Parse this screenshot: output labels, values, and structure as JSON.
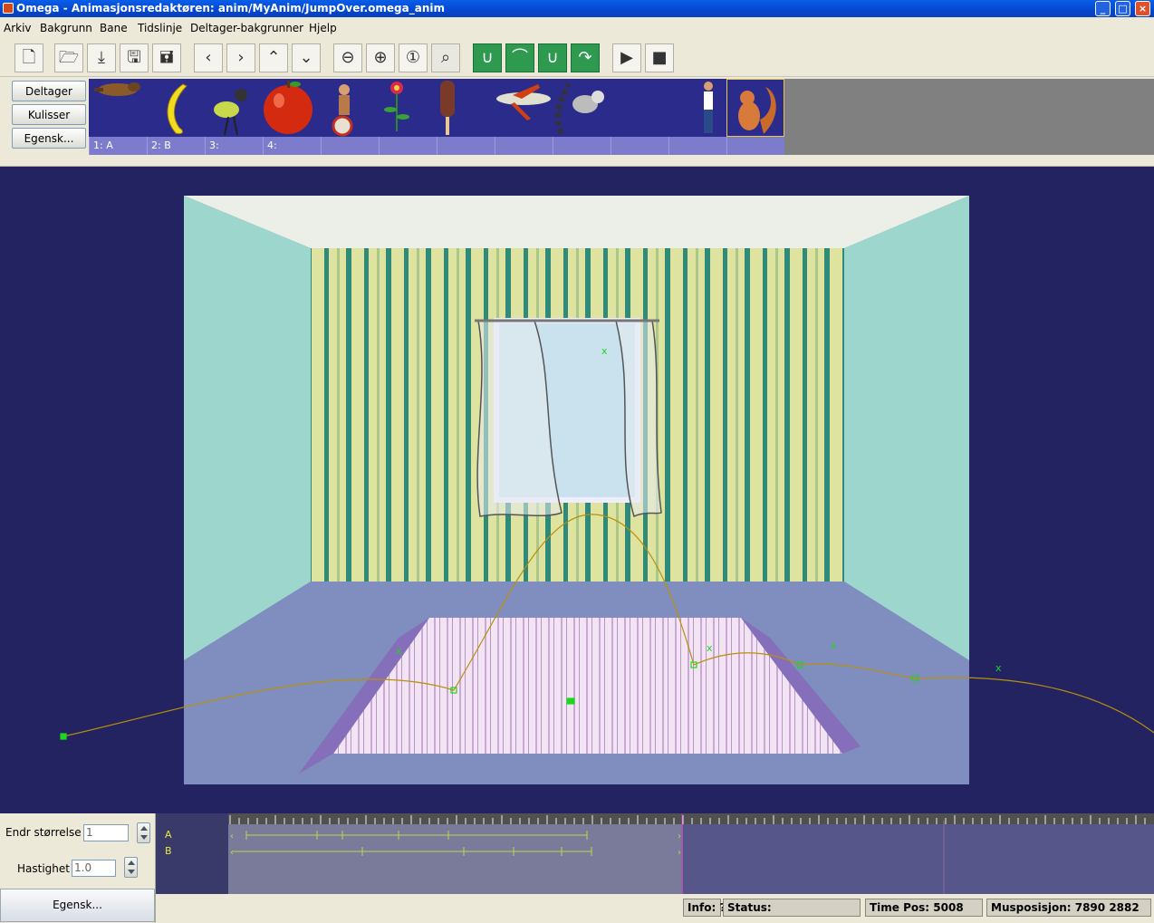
{
  "window": {
    "title": "Omega - Animasjonsredaktøren: anim/MyAnim/JumpOver.omega_anim",
    "min_label": "_",
    "max_label": "□",
    "close_label": "×"
  },
  "menu": [
    "Arkiv",
    "Bakgrunn",
    "Bane",
    "Tidslinje",
    "Deltager-bakgrunner",
    "Hjelp"
  ],
  "toolbar": {
    "icons": [
      "new-file-icon",
      "open-folder-icon",
      "open-web-icon",
      "save-icon",
      "save-as-icon",
      "arrow-left-icon",
      "arrow-right-icon",
      "arrow-up-icon",
      "arrow-down-icon",
      "zoom-out-icon",
      "zoom-in-icon",
      "zoom-actual-icon",
      "zoom-fit-icon",
      "path-add-icon",
      "path-curve-icon",
      "path-plus-one-icon",
      "path-half-icon",
      "play-icon",
      "stop-icon"
    ]
  },
  "side_buttons": {
    "deltager": "Deltager",
    "kulisser": "Kulisser",
    "egensk": "Egensk..."
  },
  "participants": {
    "items": [
      "beaver",
      "banana",
      "bird",
      "apple",
      "clown",
      "flower",
      "ice-cream",
      "airplane",
      "lemur",
      "boy",
      "frog",
      "squirrel"
    ],
    "labels": [
      "1: A",
      "2: B",
      "3:",
      "4:",
      "",
      "",
      "",
      "",
      "",
      "",
      "",
      ""
    ]
  },
  "bottom": {
    "endr_label": "Endr størrelse",
    "endr_value": "1",
    "hastighet_label": "Hastighet",
    "hastighet_value": "1.0",
    "egensk_label": "Egensk...",
    "tracks": [
      "A",
      "B"
    ]
  },
  "status": {
    "info": "Info: ?",
    "status": "Status:",
    "timepos": "Time Pos: 5008",
    "mouse": "Musposisjon: 7890 2882"
  },
  "colors": {
    "canvas_bg": "#232362",
    "wall_green": "#dfe3a0",
    "stripe_teal": "#2f8a7a",
    "side_wall": "#9dd6cc",
    "floor": "#7a88b8",
    "path_line": "#b8900a",
    "marker_green": "#1ed61e"
  }
}
